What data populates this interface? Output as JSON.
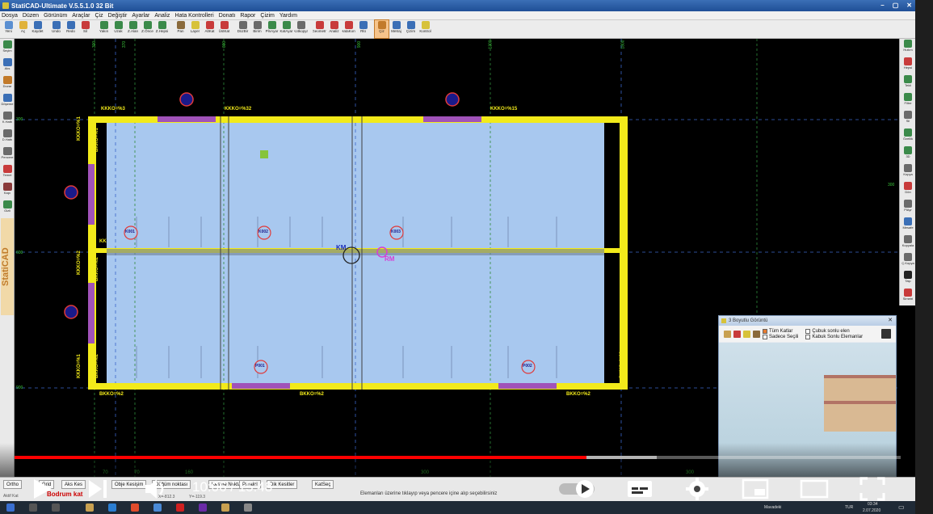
{
  "window": {
    "title": "StatiCAD-Ultimate   V.5.5.1.0  32 Bit"
  },
  "menu": [
    "Dosya",
    "Düzen",
    "Görünüm",
    "Araçlar",
    "Çiz",
    "Değiştir",
    "Ayarlar",
    "Analiz",
    "Hata Kontrolleri",
    "Donatı",
    "Rapor",
    "Çizim",
    "Yardım"
  ],
  "toolbar": [
    {
      "label": "Yeni",
      "icon": "new-file-icon",
      "color": "#5b8fd1"
    },
    {
      "label": "Aç",
      "icon": "open-folder-icon",
      "color": "#e0b23b"
    },
    {
      "label": "Kaydet",
      "icon": "save-icon",
      "color": "#3b6fb6"
    },
    {
      "label": "Undo",
      "icon": "undo-icon",
      "color": "#3b6fb6"
    },
    {
      "label": "Redo",
      "icon": "redo-icon",
      "color": "#3b6fb6"
    },
    {
      "label": "Sil",
      "icon": "delete-icon",
      "color": "#c83b3b"
    },
    {
      "label": "Yakın",
      "icon": "zoom-in-icon",
      "color": "#3b8a4a"
    },
    {
      "label": "Uzak",
      "icon": "zoom-out-icon",
      "color": "#3b8a4a"
    },
    {
      "label": "Z.Alan",
      "icon": "zoom-window-icon",
      "color": "#3b8a4a"
    },
    {
      "label": "Z.Önce",
      "icon": "zoom-previous-icon",
      "color": "#3b8a4a"
    },
    {
      "label": "Z.Hepsi",
      "icon": "zoom-all-icon",
      "color": "#3b8a4a"
    },
    {
      "label": "Pan",
      "icon": "pan-icon",
      "color": "#8a6a3b"
    },
    {
      "label": "Layer",
      "icon": "layer-icon",
      "color": "#d7c23a"
    },
    {
      "label": "AltKat",
      "icon": "lower-floor-icon",
      "color": "#c83b3b"
    },
    {
      "label": "ÜstKat",
      "icon": "upper-floor-icon",
      "color": "#c83b3b"
    },
    {
      "label": "DüzBir",
      "icon": "edit-unit-icon",
      "color": "#6a6a6a"
    },
    {
      "label": "Birim",
      "icon": "units-icon",
      "color": "#6a6a6a"
    },
    {
      "label": "PlnAyar",
      "icon": "plan-settings-icon",
      "color": "#3b8a4a"
    },
    {
      "label": "KatAyar",
      "icon": "floor-settings-icon",
      "color": "#3b8a4a"
    },
    {
      "label": "Kotkopya",
      "icon": "level-copy-icon",
      "color": "#6a6a6a"
    },
    {
      "label": "Geometri",
      "icon": "geometry-icon",
      "color": "#c83b3b"
    },
    {
      "label": "Analiz",
      "icon": "analysis-icon",
      "color": "#c83b3b"
    },
    {
      "label": "HataKont",
      "icon": "error-check-icon",
      "color": "#c83b3b"
    },
    {
      "label": "Rlü",
      "icon": "reinforcement-icon",
      "color": "#3b6fb6"
    },
    {
      "label": "Çiz",
      "icon": "draw-icon",
      "color": "#c27a2a",
      "active": true
    },
    {
      "label": "Metraj",
      "icon": "quantity-icon",
      "color": "#3b6fb6"
    },
    {
      "label": "Çizim",
      "icon": "drawing-icon",
      "color": "#3b6fb6"
    },
    {
      "label": "Kontrol",
      "icon": "warning-icon",
      "color": "#d7c23a"
    }
  ],
  "left_tools": [
    {
      "label": "Seçim",
      "icon": "select-icon",
      "color": "#3b8a4a"
    },
    {
      "label": "Aks",
      "icon": "axis-icon",
      "color": "#3b6fb6"
    },
    {
      "label": "Duvar",
      "icon": "wall-icon",
      "color": "#c27a2a"
    },
    {
      "label": "Döşeme",
      "icon": "slab-icon",
      "color": "#3b6fb6"
    },
    {
      "label": "K.Hattı",
      "icon": "section-line-icon",
      "color": "#6a6a6a"
    },
    {
      "label": "D.Hattı",
      "icon": "dimension-line-icon",
      "color": "#6a6a6a"
    },
    {
      "label": "Pencere",
      "icon": "window-icon",
      "color": "#6a6a6a"
    },
    {
      "label": "Temel",
      "icon": "foundation-icon",
      "color": "#c83b3b"
    },
    {
      "label": "Kapı",
      "icon": "door-icon",
      "color": "#8a3b3b"
    },
    {
      "label": "Gizli",
      "icon": "hidden-icon",
      "color": "#3b8a4a"
    }
  ],
  "logo_text": "StatiCAD",
  "right_tools": [
    {
      "label": "Hızlım",
      "icon": "fast-view-icon",
      "color": "#3b8a4a"
    },
    {
      "label": "Hepsi",
      "icon": "all-icon",
      "color": "#c83b3b"
    },
    {
      "label": "Tekli",
      "icon": "single-icon",
      "color": "#3b8a4a"
    },
    {
      "label": "Filtre",
      "icon": "filter-icon",
      "color": "#3b8a4a"
    },
    {
      "label": "Sil",
      "icon": "erase-icon",
      "color": "#6a6a6a"
    },
    {
      "label": "Özellik",
      "icon": "properties-icon",
      "color": "#3b8a4a"
    },
    {
      "label": "3D",
      "icon": "3d-icon",
      "color": "#3b8a4a"
    },
    {
      "label": "Kopya",
      "icon": "copy-icon",
      "color": "#6a6a6a"
    },
    {
      "label": "Dön",
      "icon": "rotate-icon",
      "color": "#c83b3b"
    },
    {
      "label": "PlAyr",
      "icon": "plan-adjust-icon",
      "color": "#6a6a6a"
    },
    {
      "label": "Mesafe",
      "icon": "distance-icon",
      "color": "#3b6fb6"
    },
    {
      "label": "Kopyala",
      "icon": "duplicate-icon",
      "color": "#6a6a6a"
    },
    {
      "label": "Ç.Kopya",
      "icon": "multi-copy-icon",
      "color": "#6a6a6a"
    },
    {
      "label": "Taşı",
      "icon": "move-icon",
      "color": "#222"
    },
    {
      "label": "Simetri",
      "icon": "mirror-icon",
      "color": "#c83b3b"
    }
  ],
  "plan": {
    "top_axis_labels": [
      "300",
      "370",
      "600",
      "900",
      "1300",
      "1800"
    ],
    "left_axis_labels": [
      "300",
      "600",
      "900"
    ],
    "right_axis_label": "300",
    "edge_labels": {
      "top_left": "KKKO=%3",
      "top_mid": "KKKO=%32",
      "top_right": "KKKO=%15",
      "left_top": "KKKO=%1",
      "left_top_b": "BKKO=%1",
      "left_mid": "KKKO=%2",
      "left_mid_b": "BKKO=%2",
      "left_bot": "KKKO=%1",
      "left_bot_b": "BKKO=%2",
      "right_bot": "BKKO=%32",
      "bottom_left": "BKKO=%2",
      "bottom_mid": "BKKO=%2",
      "bottom_right": "BKKO=%2",
      "mid_marker": "KK"
    },
    "beam_tags": [
      "K001",
      "K002",
      "K003",
      "P001",
      "P002"
    ],
    "km_label": "KM",
    "rm_label": "RM",
    "bottom_dimensions": [
      "70",
      "70",
      "160",
      "300",
      "300",
      "300"
    ]
  },
  "viewer3d": {
    "title": "3 Boyutlu Görüntü",
    "chk_all_floors": "Tüm Katlar",
    "chk_selected_only": "Sadece Seçili",
    "chk_bar_ends": "Çubuk sonlu elen",
    "chk_shell_ends": "Kabuk Sonlu Elemanlar",
    "close": "✕"
  },
  "video": {
    "current_time": "10:06",
    "total_time": "15:48",
    "separator": " / ",
    "progress": 0.6455,
    "buffered": 0.7247
  },
  "status": {
    "tabs": [
      "Ortho",
      "Grid",
      "Aks Kes",
      "Obje Kesişim",
      "Düğüm noktası",
      "Kesme Noktaları",
      "Paralel",
      "Dik Kesitler",
      "KatSeç"
    ],
    "floor": "Bodrum kat",
    "coord_x": "X=-812.3",
    "coord_y": "Y=-119.3",
    "small_left": "Aktif Kat",
    "message": "Elemanları üzerine tıklayıp veya pencere içine alıp seçebilirsiniz"
  },
  "tray": {
    "lang": "TUR",
    "time": "03:34",
    "date": "2.07.2020",
    "weather": "Mavadeki"
  }
}
